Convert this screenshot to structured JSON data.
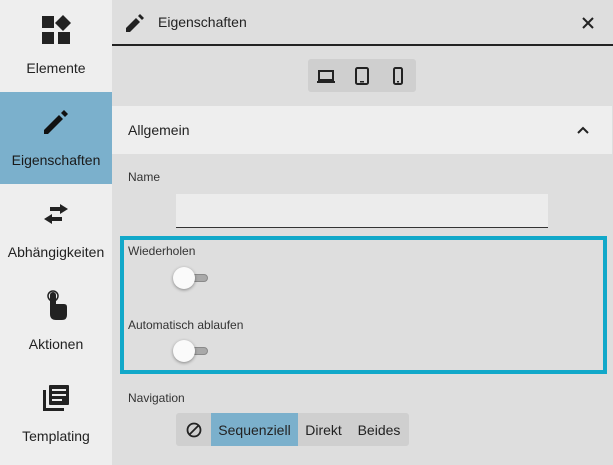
{
  "sidebar": {
    "items": [
      {
        "label": "Elemente",
        "icon": "shapes-icon",
        "active": false
      },
      {
        "label": "Eigenschaften",
        "icon": "pencil-icon",
        "active": true
      },
      {
        "label": "Abhängigkeiten",
        "icon": "swap-arrows-icon",
        "active": false
      },
      {
        "label": "Aktionen",
        "icon": "touch-hand-icon",
        "active": false
      },
      {
        "label": "Templating",
        "icon": "library-books-icon",
        "active": false
      }
    ]
  },
  "header": {
    "title": "Eigenschaften",
    "icon": "pencil-icon",
    "close_icon": "close-icon"
  },
  "device_toggle": {
    "options": [
      "laptop-icon",
      "tablet-icon",
      "phone-icon"
    ]
  },
  "section": {
    "title": "Allgemein",
    "expanded": true
  },
  "fields": {
    "name": {
      "label": "Name",
      "value": "",
      "placeholder": ""
    },
    "repeat": {
      "label": "Wiederholen",
      "on": false
    },
    "autoplay": {
      "label": "Automatisch ablaufen",
      "on": false
    },
    "navigation": {
      "label": "Navigation",
      "options": [
        "Sequenziell",
        "Direkt",
        "Beides"
      ],
      "selected": "Sequenziell",
      "none_icon": "block-icon"
    }
  },
  "colors": {
    "accent": "#7bb0cc",
    "highlight": "#12a8c9"
  }
}
